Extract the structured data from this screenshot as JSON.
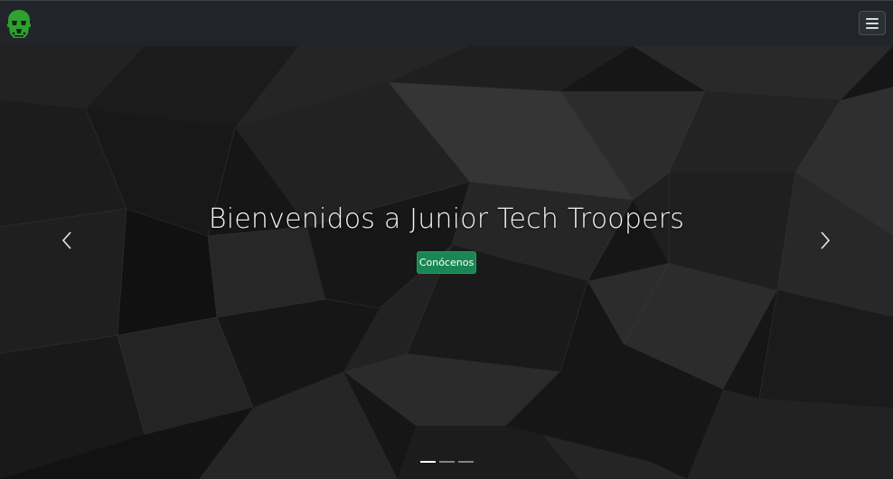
{
  "navbar": {
    "logo_icon": "stormtrooper-helmet-icon",
    "logo_color": "#2fa12f",
    "toggler_icon": "hamburger-menu-icon",
    "background": "#212529"
  },
  "carousel": {
    "title": "Bienvenidos a Junior Tech Troopers",
    "cta_label": "Conócenos",
    "cta_color": "#198754",
    "prev_icon": "chevron-left-icon",
    "next_icon": "chevron-right-icon",
    "indicator_count": 3,
    "active_indicator": 1
  }
}
